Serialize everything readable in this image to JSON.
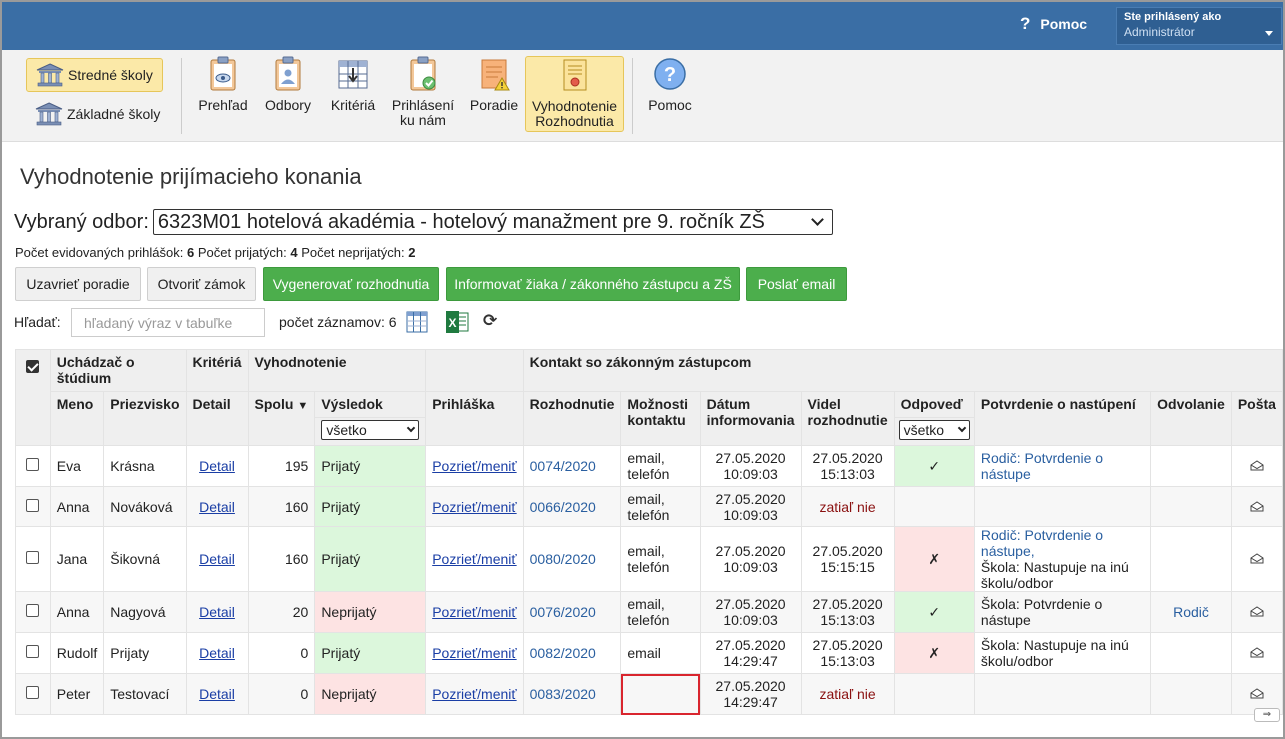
{
  "header": {
    "help_label": "Pomoc",
    "user_line1": "Ste prihlásený ako",
    "user_line2": "Administrátor"
  },
  "toolbar": {
    "schools": [
      "Stredné školy",
      "Základné školy"
    ],
    "tools": [
      {
        "line1": "Prehľad",
        "line2": ""
      },
      {
        "line1": "Odbory",
        "line2": ""
      },
      {
        "line1": "Kritériá",
        "line2": ""
      },
      {
        "line1": "Prihlásení",
        "line2": "ku nám"
      },
      {
        "line1": "Poradie",
        "line2": ""
      },
      {
        "line1": "Vyhodnotenie",
        "line2": "Rozhodnutia"
      },
      {
        "line1": "Pomoc",
        "line2": ""
      }
    ]
  },
  "page": {
    "title": "Vyhodnotenie prijímacieho konania",
    "odbor_label": "Vybraný odbor:",
    "odbor_value": "6323M01 hotelová akadémia - hotelový manažment pre 9. ročník ZŠ",
    "counts": {
      "evid_label": "Počet evidovaných prihlášok:",
      "evid_value": "6",
      "prij_label": "Počet prijatých:",
      "prij_value": "4",
      "neprij_label": "Počet neprijatých:",
      "neprij_value": "2"
    },
    "buttons": {
      "close_order": "Uzavrieť poradie",
      "open_lock": "Otvoriť zámok",
      "generate": "Vygenerovať rozhodnutia",
      "inform": "Informovať žiaka / zákonného zástupcu a ZŠ",
      "send_email": "Poslať email"
    },
    "search": {
      "label": "Hľadať:",
      "placeholder": "hľadaný výraz v tabuľke",
      "count_label": "počet záznamov: 6"
    }
  },
  "table": {
    "groups": {
      "applicant": "Uchádzač o štúdium",
      "criteria": "Kritériá",
      "evaluation": "Vyhodnotenie",
      "contact": "Kontakt so zákonným zástupcom"
    },
    "columns": {
      "meno": "Meno",
      "priezvisko": "Priezvisko",
      "detail": "Detail",
      "spolu": "Spolu",
      "vysledok": "Výsledok",
      "prihlaska": "Prihláška",
      "rozhodnutie": "Rozhodnutie",
      "moznosti1": "Možnosti",
      "moznosti2": "kontaktu",
      "datum1": "Dátum",
      "datum2": "informovania",
      "videl1": "Videl",
      "videl2": "rozhodnutie",
      "odpoved": "Odpoveď",
      "potvrdenie": "Potvrdenie o nastúpení",
      "odvolanie": "Odvolanie",
      "posta": "Pošta"
    },
    "filters": {
      "vysledok": "všetko",
      "odpoved": "všetko"
    },
    "rows": [
      {
        "meno": "Eva",
        "priezvisko": "Krásna",
        "detail": "Detail",
        "spolu": "195",
        "vysledok": "Prijatý",
        "prihlaska": "Pozrieť/meniť",
        "rozhodnutie": "0074/2020",
        "kontakt1": "email,",
        "kontakt2": "telefón",
        "datum1": "27.05.2020",
        "datum2": "10:09:03",
        "videl1": "27.05.2020",
        "videl2": "15:13:03",
        "odpoved": "✓",
        "potvrdenie1": "Rodič: Potvrdenie o nástupe",
        "potvrdenie2": "",
        "potvrdenie3": "",
        "odvolanie": ""
      },
      {
        "meno": "Anna",
        "priezvisko": "Nováková",
        "detail": "Detail",
        "spolu": "160",
        "vysledok": "Prijatý",
        "prihlaska": "Pozrieť/meniť",
        "rozhodnutie": "0066/2020",
        "kontakt1": "email,",
        "kontakt2": "telefón",
        "datum1": "27.05.2020",
        "datum2": "10:09:03",
        "videl1": "zatiaľ nie",
        "videl2": "",
        "odpoved": "",
        "potvrdenie1": "",
        "potvrdenie2": "",
        "potvrdenie3": "",
        "odvolanie": ""
      },
      {
        "meno": "Jana",
        "priezvisko": "Šikovná",
        "detail": "Detail",
        "spolu": "160",
        "vysledok": "Prijatý",
        "prihlaska": "Pozrieť/meniť",
        "rozhodnutie": "0080/2020",
        "kontakt1": "email,",
        "kontakt2": "telefón",
        "datum1": "27.05.2020",
        "datum2": "10:09:03",
        "videl1": "27.05.2020",
        "videl2": "15:15:15",
        "odpoved": "✗",
        "potvrdenie1": "Rodič: Potvrdenie o nástupe,",
        "potvrdenie2": "Škola: Nastupuje na inú",
        "potvrdenie3": "školu/odbor",
        "odvolanie": ""
      },
      {
        "meno": "Anna",
        "priezvisko": "Nagyová",
        "detail": "Detail",
        "spolu": "20",
        "vysledok": "Neprijatý",
        "prihlaska": "Pozrieť/meniť",
        "rozhodnutie": "0076/2020",
        "kontakt1": "email,",
        "kontakt2": "telefón",
        "datum1": "27.05.2020",
        "datum2": "10:09:03",
        "videl1": "27.05.2020",
        "videl2": "15:13:03",
        "odpoved": "✓",
        "potvrdenie1": "",
        "potvrdenie2": "Škola: Potvrdenie o nástupe",
        "potvrdenie3": "",
        "odvolanie": "Rodič"
      },
      {
        "meno": "Rudolf",
        "priezvisko": "Prijaty",
        "detail": "Detail",
        "spolu": "0",
        "vysledok": "Prijatý",
        "prihlaska": "Pozrieť/meniť",
        "rozhodnutie": "0082/2020",
        "kontakt1": "email",
        "kontakt2": "",
        "datum1": "27.05.2020",
        "datum2": "14:29:47",
        "videl1": "27.05.2020",
        "videl2": "15:13:03",
        "odpoved": "✗",
        "potvrdenie1": "",
        "potvrdenie2": "Škola: Nastupuje na inú",
        "potvrdenie3": "školu/odbor",
        "odvolanie": ""
      },
      {
        "meno": "Peter",
        "priezvisko": "Testovací",
        "detail": "Detail",
        "spolu": "0",
        "vysledok": "Neprijatý",
        "prihlaska": "Pozrieť/meniť",
        "rozhodnutie": "0083/2020",
        "kontakt1": "",
        "kontakt2": "",
        "datum1": "27.05.2020",
        "datum2": "14:29:47",
        "videl1": "zatiaľ nie",
        "videl2": "",
        "odpoved": "",
        "potvrdenie1": "",
        "potvrdenie2": "",
        "potvrdenie3": "",
        "odvolanie": ""
      }
    ]
  },
  "colors": {
    "topbar": "#3a6ea5",
    "accept_bg": "#dcf7dc",
    "reject_bg": "#fde3e3",
    "button_green": "#4cae4c",
    "highlight_box": "#d9252e"
  },
  "scroll_hint": "⇒"
}
